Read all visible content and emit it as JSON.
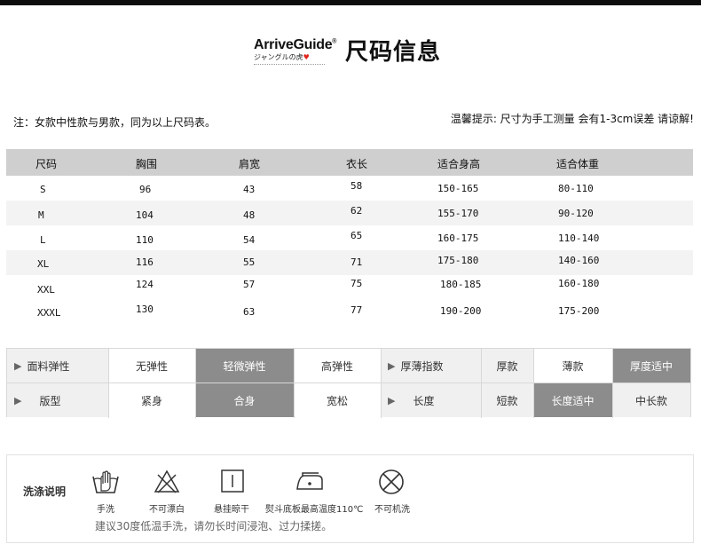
{
  "header": {
    "brand": "ArriveGuide",
    "brand_mark": "®",
    "brand_sub": "ジャングルの虎",
    "title": "尺码信息"
  },
  "notes": {
    "left": "注：女款中性款与男款，同为以上尺码表。",
    "right": "温馨提示: 尺寸为手工测量 会有1-3cm误差 请谅解!"
  },
  "size_table": {
    "headers": [
      "尺码",
      "胸围",
      "肩宽",
      "衣长",
      "适合身高",
      "适合体重"
    ],
    "rows": [
      [
        "S",
        "96",
        "43",
        "58",
        "150-165",
        "80-110"
      ],
      [
        "M",
        "104",
        "48",
        "62",
        "155-170",
        "90-120"
      ],
      [
        "L",
        "110",
        "54",
        "65",
        "160-175",
        "110-140"
      ],
      [
        "XL",
        "116",
        "55",
        "71",
        "175-180",
        "140-160"
      ],
      [
        "XXL",
        "124",
        "57",
        "75",
        "180-185",
        "160-180"
      ],
      [
        "XXXL",
        "130",
        "63",
        "77",
        "190-200",
        "175-200"
      ]
    ]
  },
  "attributes": {
    "row1": {
      "label": "面料弹性",
      "options": [
        "无弹性",
        "轻微弹性",
        "高弹性"
      ],
      "selected": "轻微弹性",
      "label2": "厚薄指数",
      "options2": [
        "厚款",
        "薄款",
        "厚度适中"
      ],
      "selected2": "厚度适中"
    },
    "row2": {
      "label": "版型",
      "options": [
        "紧身",
        "合身",
        "宽松"
      ],
      "selected": "合身",
      "label2": "长度",
      "options2": [
        "短款",
        "长度适中",
        "中长款"
      ],
      "selected2": "长度适中"
    },
    "marker": "▶"
  },
  "washing": {
    "title": "洗涤说明",
    "items": [
      {
        "icon": "hand-wash-icon",
        "label": "手洗"
      },
      {
        "icon": "no-bleach-icon",
        "label": "不可漂白"
      },
      {
        "icon": "hang-dry-icon",
        "label": "悬挂晾干"
      },
      {
        "icon": "iron-icon",
        "label": "熨斗底板最高温度110℃"
      },
      {
        "icon": "no-machine-wash-icon",
        "label": "不可机洗"
      }
    ],
    "tip": "建议30度低温手洗，请勿长时间浸泡、过力揉搓。"
  },
  "colors": {
    "selected_bg": "#8c8c8c",
    "table_header_bg": "#cfcfcf",
    "heart": "#e0261c"
  }
}
